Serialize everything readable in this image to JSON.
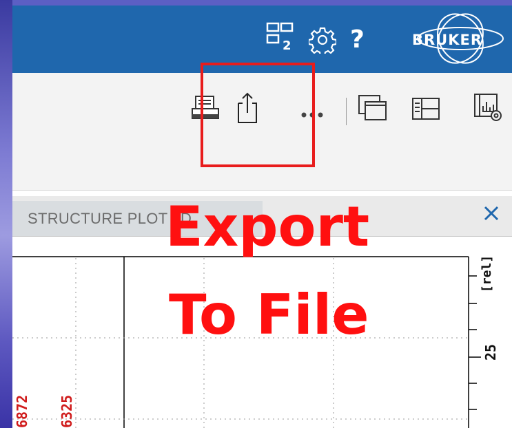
{
  "titlebar": {
    "help_label": "?",
    "brand": "BRUKER"
  },
  "tabs": {
    "active_tab_label": "STRUCTURE   PLOT   3D"
  },
  "annotation": {
    "line1": "Export",
    "line2": "To File"
  },
  "plot": {
    "axis_unit_label": "[rel]",
    "axis_tick_25": "25",
    "peak_labels": [
      "6872",
      "6325"
    ]
  },
  "colors": {
    "titlebar": "#1f67ad",
    "highlight": "#e81c1c",
    "annotation_text": "#ff1010",
    "peak_label": "#d01c1c"
  },
  "icons": [
    "layout-2-icon",
    "gear-icon",
    "help-icon",
    "bruker-logo",
    "print-icon",
    "export-icon",
    "more-icon",
    "window-icon",
    "split-view-icon",
    "chart-settings-icon",
    "close-icon"
  ]
}
